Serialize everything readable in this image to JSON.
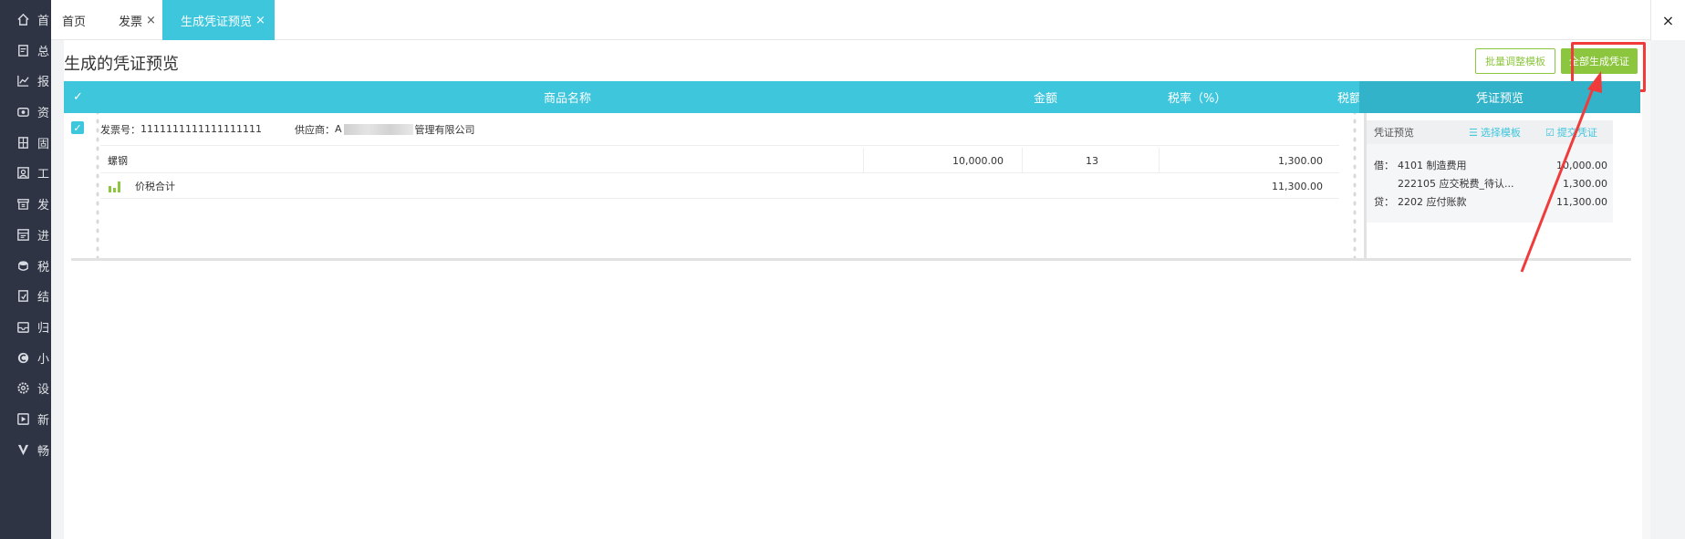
{
  "sidebar": {
    "items": [
      {
        "label": "首",
        "icon": "home-icon"
      },
      {
        "label": "总",
        "icon": "ledger-icon"
      },
      {
        "label": "报",
        "icon": "chart-icon"
      },
      {
        "label": "资",
        "icon": "asset-icon"
      },
      {
        "label": "固",
        "icon": "building-icon"
      },
      {
        "label": "工",
        "icon": "payroll-icon"
      },
      {
        "label": "发",
        "icon": "invoice-icon"
      },
      {
        "label": "进",
        "icon": "inventory-icon"
      },
      {
        "label": "税",
        "icon": "tax-icon"
      },
      {
        "label": "结",
        "icon": "close-period-icon"
      },
      {
        "label": "归",
        "icon": "archive-icon"
      },
      {
        "label": "小",
        "icon": "mini-program-icon"
      },
      {
        "label": "设",
        "icon": "settings-icon"
      },
      {
        "label": "新",
        "icon": "new-feature-icon"
      },
      {
        "label": "畅",
        "icon": "v-logo-icon"
      }
    ]
  },
  "tabs": [
    {
      "label": "首页",
      "closable": false
    },
    {
      "label": "发票",
      "closable": true,
      "close": "×"
    },
    {
      "label": "生成凭证预览",
      "closable": true,
      "active": true,
      "close": "×"
    }
  ],
  "window_close": "×",
  "page": {
    "title": "生成的凭证预览",
    "batch_button": "批量调整模板",
    "generate_all_button": "全部生成凭证"
  },
  "table": {
    "check_header": "✓",
    "columns": {
      "name": "商品名称",
      "amount": "金额",
      "tax_rate": "税率（%）",
      "tax": "税额",
      "voucher": "凭证预览"
    }
  },
  "invoice": {
    "checked": "✓",
    "number_label": "发票号：",
    "number": "1111111111111111111",
    "supplier_label": "供应商：",
    "supplier_prefix": "A",
    "supplier_suffix": "管理有限公司",
    "item": {
      "name": "螺钢",
      "amount": "10,000.00",
      "tax_rate": "13",
      "tax": "1,300.00"
    },
    "total": {
      "label": "价税合计",
      "amount": "11,300.00"
    }
  },
  "voucher": {
    "header": "凭证预览",
    "select_template": "选择模板",
    "submit": "提交凭证",
    "entries": [
      {
        "dc": "借：",
        "account": "4101 制造费用",
        "amount": "10,000.00"
      },
      {
        "dc": "",
        "account": "222105 应交税费_待认...",
        "amount": "1,300.00"
      },
      {
        "dc": "贷：",
        "account": "2202 应付账款",
        "amount": "11,300.00"
      }
    ]
  },
  "colors": {
    "sidebar": "#2f3444",
    "accent": "#3ec6dd",
    "green": "#8cc63e",
    "highlight": "#f03b3b"
  }
}
